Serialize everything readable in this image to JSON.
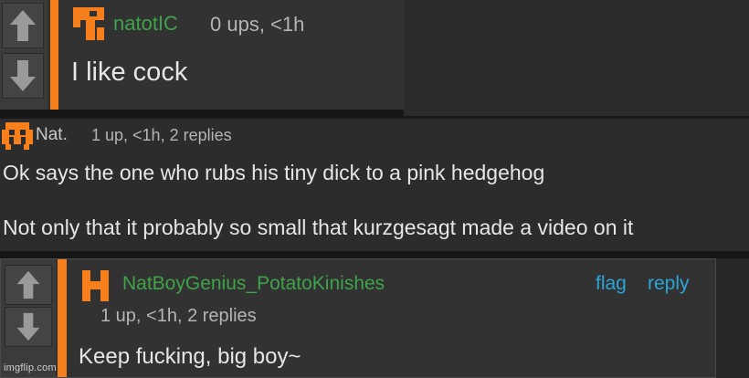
{
  "comments": [
    {
      "username": "natotIC",
      "meta": "0 ups, <1h",
      "text": "I like cock"
    },
    {
      "username": "Nat.",
      "meta": "1 up, <1h, 2 replies",
      "lines": [
        "Ok says the one who rubs his tiny dick to a pink hedgehog",
        "Not only that it probably so small that kurzgesagt made a video on it"
      ]
    },
    {
      "username": "NatBoyGenius_PotatoKinishes",
      "meta": "1 up, <1h, 2 replies",
      "text": "Keep fucking, big boy~",
      "actions": {
        "flag": "flag",
        "reply": "reply"
      }
    }
  ],
  "watermark": "imgflip.com",
  "icons": {
    "upvote": "arrow-up-icon",
    "downvote": "arrow-down-icon",
    "avatar": "pixel-avatar-icon"
  },
  "colors": {
    "accent": "#f7801c",
    "username": "#3fa34a",
    "link": "#2ba5d9",
    "background": "#2b2b2b"
  }
}
